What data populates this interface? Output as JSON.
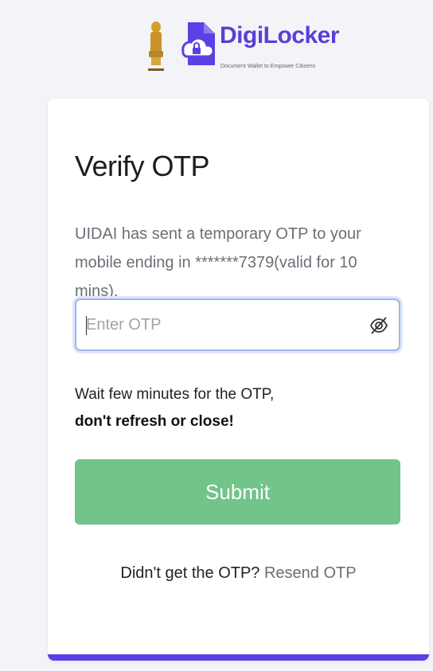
{
  "header": {
    "brand_name": "DigiLocker",
    "tagline": "Document Wallet to Empower Citizens",
    "brand_color": "#5b3fd6",
    "emblem_icon": "national-emblem-icon",
    "logo_icon": "digilocker-cloud-lock-icon"
  },
  "card": {
    "title": "Verify OTP",
    "description": "UIDAI has sent a temporary OTP to your mobile ending in *******7379(valid for 10 mins).",
    "otp_placeholder": "Enter OTP",
    "otp_value": "",
    "visibility_icon": "eye-off-icon",
    "wait_line1": "Wait few minutes for the OTP,",
    "wait_line2": "don't refresh or close!",
    "submit_label": "Submit",
    "submit_color": "#72c48a",
    "resend_prompt": "Didn't get the OTP?",
    "resend_link": "Resend OTP",
    "accent_color": "#5d3fe6"
  }
}
